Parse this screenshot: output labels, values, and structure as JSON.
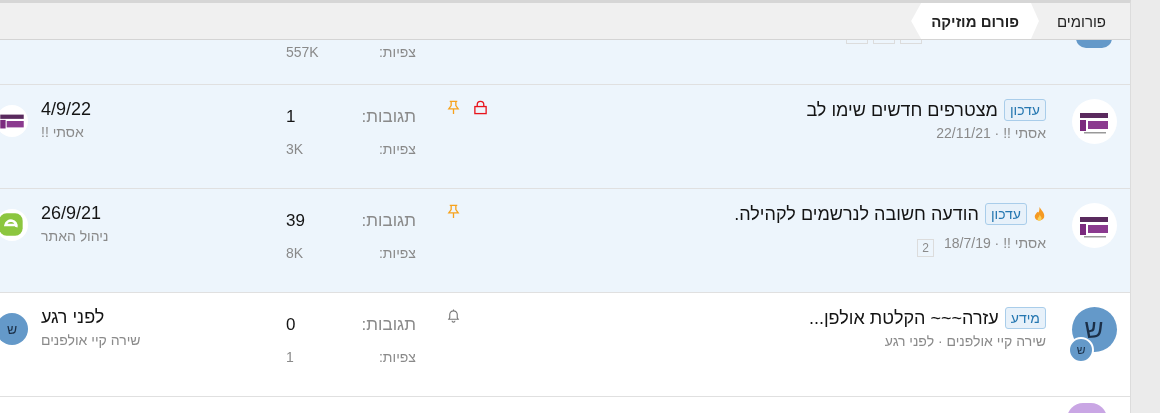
{
  "breadcrumb": [
    {
      "label": "פורומים",
      "selected": false
    },
    {
      "label": "פורום מוזיקה",
      "selected": true
    }
  ],
  "threads": [
    {
      "kind": "cut-top",
      "sticky": true,
      "avatar": {
        "kind": "letter"
      },
      "pages": [
        {
          "kind": "hidden"
        },
        {
          "kind": "hidden"
        },
        {
          "kind": "hidden"
        }
      ],
      "views_label": "צפיות:",
      "views": "557K"
    },
    {
      "kind": "full",
      "sticky": true,
      "avatar": {
        "kind": "logo-solo"
      },
      "hot": false,
      "prefix": "עדכון",
      "title": "מצטרפים חדשים שימו לב",
      "meta": "אסתי !! · 22/11/21",
      "pinned": true,
      "locked": true,
      "watched": false,
      "replies_label": "תגובות:",
      "replies": "1",
      "views_label": "צפיות:",
      "views": "3K",
      "last_date": "4/9/22",
      "last_user": "אסתי !!",
      "last_avatar": {
        "kind": "logo-solo"
      }
    },
    {
      "kind": "full",
      "sticky": true,
      "avatar": {
        "kind": "logo-solo"
      },
      "hot": true,
      "prefix": "עדכון",
      "title": "הודעה חשובה לנרשמים לקהילה.",
      "meta": "אסתי !! · 18/7/19",
      "pages": [
        {
          "kind": "link",
          "label": "2"
        }
      ],
      "pinned": true,
      "locked": false,
      "watched": false,
      "replies_label": "תגובות:",
      "replies": "39",
      "views_label": "צפיות:",
      "views": "8K",
      "last_date": "26/9/21",
      "last_user": "ניהול האתר",
      "last_avatar": {
        "kind": "logo-green"
      }
    },
    {
      "kind": "full",
      "sticky": false,
      "avatar": {
        "kind": "letter",
        "letter": "ש",
        "badge": "ש"
      },
      "hot": false,
      "prefix": "מידע",
      "title": "עזרה~~~ הקלטת אולפן...",
      "meta": "שירה קיי אולפנים · לפני רגע",
      "pinned": false,
      "locked": false,
      "watched": true,
      "replies_label": "תגובות:",
      "replies": "0",
      "views_label": "צפיות:",
      "views": "1",
      "last_date": "לפני רגע",
      "last_user": "שירה קיי אולפנים",
      "last_avatar": {
        "kind": "letter",
        "letter": "ש"
      }
    },
    {
      "kind": "cut-bottom",
      "sticky": false,
      "avatar": {
        "kind": "violet"
      }
    }
  ]
}
